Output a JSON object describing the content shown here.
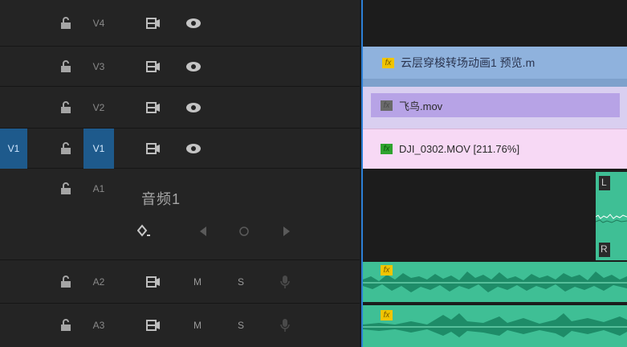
{
  "video_tracks": [
    {
      "id": "V4",
      "source_patch": "",
      "active": false
    },
    {
      "id": "V3",
      "source_patch": "",
      "active": false
    },
    {
      "id": "V2",
      "source_patch": "",
      "active": false
    },
    {
      "id": "V1",
      "source_patch": "V1",
      "active": true
    }
  ],
  "audio_tracks": [
    {
      "id": "A1",
      "name": "音频1"
    },
    {
      "id": "A2",
      "mute_label": "M",
      "solo_label": "S"
    },
    {
      "id": "A3",
      "mute_label": "M",
      "solo_label": "S"
    }
  ],
  "clips": [
    {
      "name": "云层穿梭转场动画1 预览.m",
      "fx": "fx",
      "track": "V3"
    },
    {
      "name": "飞鸟.mov",
      "fx": "fx",
      "track": "V2"
    },
    {
      "name": "DJI_0302.MOV [211.76%]",
      "fx": "fx",
      "track": "V1"
    }
  ],
  "audio_clip_markers": {
    "left_channel": "L",
    "right_channel": "R",
    "fx": "fx"
  },
  "colors": {
    "panel_bg": "#242424",
    "active_blue": "#1e5a8c",
    "playhead": "#2c7fd6",
    "clip_v3": "#8fb2dd",
    "clip_v2": "#b7a3e6",
    "clip_v1": "#f7d9f5",
    "audio_clip": "#3fbf95"
  }
}
